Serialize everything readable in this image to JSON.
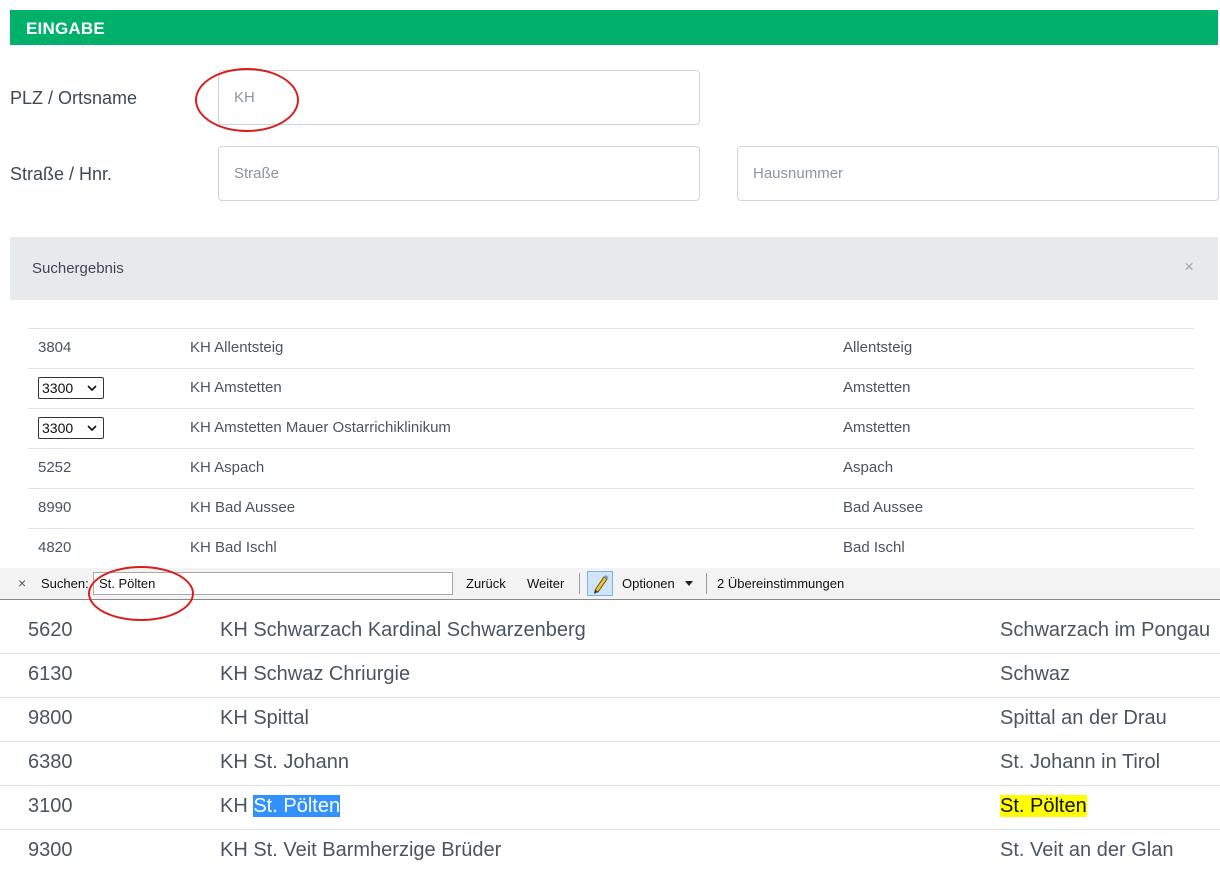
{
  "header": {
    "title": "EINGABE"
  },
  "form": {
    "plz_label": "PLZ / Ortsname",
    "plz_value": "KH",
    "street_label": "Straße / Hnr.",
    "street_placeholder": "Straße",
    "housenumber_placeholder": "Hausnummer"
  },
  "result": {
    "title": "Suchergebnis",
    "close": "×"
  },
  "results_top": [
    {
      "code": "3804",
      "name": "KH Allentsteig",
      "place": "Allentsteig",
      "dropdown": false
    },
    {
      "code": "3300",
      "name": "KH Amstetten",
      "place": "Amstetten",
      "dropdown": true
    },
    {
      "code": "3300",
      "name": "KH Amstetten Mauer Ostarrichiklinikum",
      "place": "Amstetten",
      "dropdown": true
    },
    {
      "code": "5252",
      "name": "KH Aspach",
      "place": "Aspach",
      "dropdown": false
    },
    {
      "code": "8990",
      "name": "KH Bad Aussee",
      "place": "Bad Aussee",
      "dropdown": false
    },
    {
      "code": "4820",
      "name": "KH Bad Ischl",
      "place": "Bad Ischl",
      "dropdown": false
    }
  ],
  "findbar": {
    "close": "×",
    "label": "Suchen:",
    "query": "St. Pölten",
    "back": "Zurück",
    "next": "Weiter",
    "options": "Optionen",
    "matches": "2 Übereinstimmungen"
  },
  "results_bottom": [
    {
      "code": "5620",
      "name": "KH Schwarzach Kardinal Schwarzenberg",
      "place": "Schwarzach im Pongau"
    },
    {
      "code": "6130",
      "name": "KH Schwaz Chriurgie",
      "place": "Schwaz"
    },
    {
      "code": "9800",
      "name": "KH Spittal",
      "place": "Spittal an der Drau"
    },
    {
      "code": "6380",
      "name": "KH St. Johann",
      "place": "St. Johann in Tirol"
    },
    {
      "code": "3100",
      "name_prefix": "KH ",
      "name_highlight": "St. Pölten",
      "place_highlight": "St. Pölten"
    },
    {
      "code": "9300",
      "name": "KH St. Veit Barmherzige Brüder",
      "place": "St. Veit an der Glan"
    }
  ],
  "colors": {
    "header_green": "#00b06b",
    "annotation_red": "#d81e1e",
    "selection_blue": "#3390ff",
    "match_yellow": "#ffff00"
  }
}
